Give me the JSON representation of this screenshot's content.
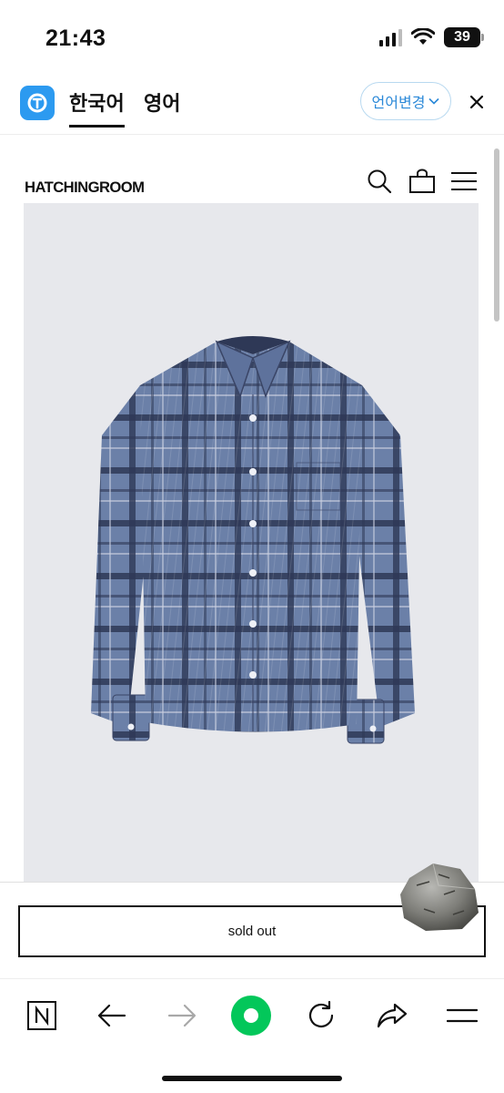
{
  "status_bar": {
    "time": "21:43",
    "battery": "39"
  },
  "translate_bar": {
    "tabs": [
      "한국어",
      "영어"
    ],
    "change_language": "언어변경"
  },
  "site": {
    "brand": "HATCHINGROOM"
  },
  "product": {
    "sold_out_label": "sold out"
  },
  "colors": {
    "accent_blue": "#2c9af0",
    "naver_green": "#03c75a",
    "image_bg": "#e7e8ec"
  },
  "icons": {
    "header": [
      "search-icon",
      "shopping-bag-icon",
      "menu-icon"
    ],
    "toolbar": [
      "naver-n-icon",
      "back-arrow-icon",
      "forward-arrow-icon",
      "green-dot-icon",
      "reload-icon",
      "share-icon",
      "hamburger-icon"
    ]
  }
}
